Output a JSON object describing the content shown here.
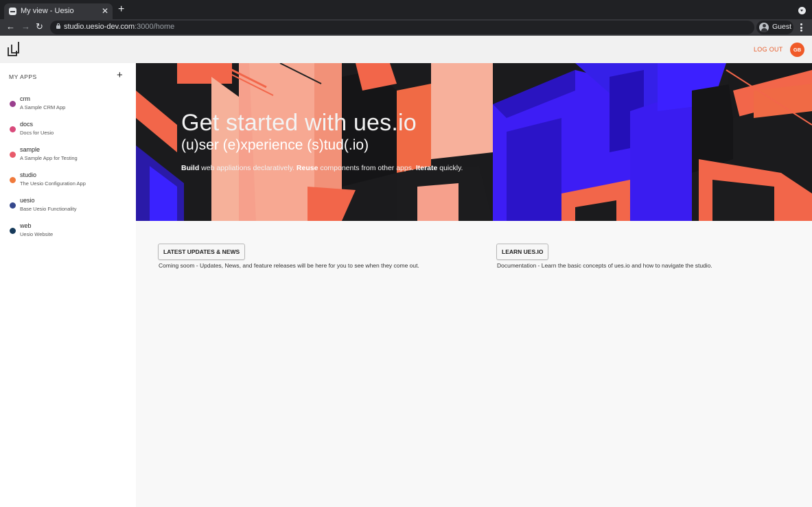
{
  "browser": {
    "tab_title": "My view - Uesio",
    "tab_close": "✕",
    "new_tab": "+",
    "url_host": "studio.uesio-dev.com",
    "url_path": ":3000/home",
    "profile_label": "Guest",
    "nav_back": "←",
    "nav_forward": "→",
    "nav_reload": "↻"
  },
  "header": {
    "logout_label": "LOG OUT",
    "avatar_initials": "GB",
    "accent_color": "#f05a28"
  },
  "sidebar": {
    "title": "MY APPS",
    "add_label": "+",
    "apps": [
      {
        "name": "crm",
        "description": "A Sample CRM App",
        "color": "#9a3f8e"
      },
      {
        "name": "docs",
        "description": "Docs for Uesio",
        "color": "#d94a7b"
      },
      {
        "name": "sample",
        "description": "A Sample App for Testing",
        "color": "#e85a6a"
      },
      {
        "name": "studio",
        "description": "The Uesio Configuration App",
        "color": "#f07a3c"
      },
      {
        "name": "uesio",
        "description": "Base Uesio Functionality",
        "color": "#34478c"
      },
      {
        "name": "web",
        "description": "Uesio Website",
        "color": "#163a5a"
      }
    ]
  },
  "hero": {
    "title": "Get started with ues.io",
    "subtitle": "(u)ser (e)xperience (s)tud(.io)",
    "tagline": {
      "build": "Build",
      "build_rest": " web appliations declaratively. ",
      "reuse": "Reuse",
      "reuse_rest": " components from other apps. ",
      "iterate": "Iterate",
      "iterate_rest": " quickly."
    }
  },
  "cards": [
    {
      "button": "LATEST UPDATES & NEWS",
      "text": "Coming soom - Updates, News, and feature releases will be here for you to see when they come out."
    },
    {
      "button": "LEARN UES.IO",
      "text": "Documentation - Learn the basic concepts of ues.io and how to navigate the studio."
    }
  ]
}
